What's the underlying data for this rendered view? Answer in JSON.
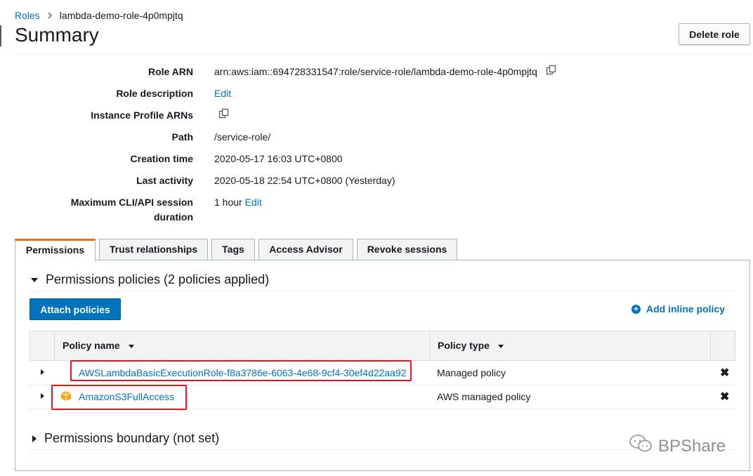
{
  "breadcrumb": {
    "root": "Roles",
    "current": "lambda-demo-role-4p0mpjtq"
  },
  "page_title": "Summary",
  "delete_button": "Delete role",
  "summary": {
    "role_arn_label": "Role ARN",
    "role_arn_value": "arn:aws:iam::694728331547:role/service-role/lambda-demo-role-4p0mpjtq",
    "role_description_label": "Role description",
    "role_description_link": "Edit",
    "instance_profile_label": "Instance Profile ARNs",
    "path_label": "Path",
    "path_value": "/service-role/",
    "creation_time_label": "Creation time",
    "creation_time_value": "2020-05-17 16:03 UTC+0800",
    "last_activity_label": "Last activity",
    "last_activity_value": "2020-05-18 22:54 UTC+0800 (Yesterday)",
    "max_session_label_1": "Maximum CLI/API session",
    "max_session_label_2": "duration",
    "max_session_value": "1 hour",
    "max_session_link": "Edit"
  },
  "tabs": [
    {
      "label": "Permissions",
      "active": true
    },
    {
      "label": "Trust relationships",
      "active": false
    },
    {
      "label": "Tags",
      "active": false
    },
    {
      "label": "Access Advisor",
      "active": false
    },
    {
      "label": "Revoke sessions",
      "active": false
    }
  ],
  "permissions": {
    "section_title": "Permissions policies (2 policies applied)",
    "attach_button": "Attach policies",
    "add_inline": "Add inline policy",
    "columns": {
      "name": "Policy name",
      "type": "Policy type"
    },
    "rows": [
      {
        "name": "AWSLambdaBasicExecutionRole-f8a3786e-6063-4e68-9cf4-30ef4d22aa92",
        "type": "Managed policy"
      },
      {
        "name": "AmazonS3FullAccess",
        "type": "AWS managed policy"
      }
    ],
    "boundary_title": "Permissions boundary (not set)"
  },
  "watermark": "BPShare",
  "colors": {
    "link": "#0073bb",
    "primary": "#0073bb",
    "tab_accent": "#ec7211",
    "highlight": "#e8131b",
    "aws_icon": "#f7a80d"
  }
}
